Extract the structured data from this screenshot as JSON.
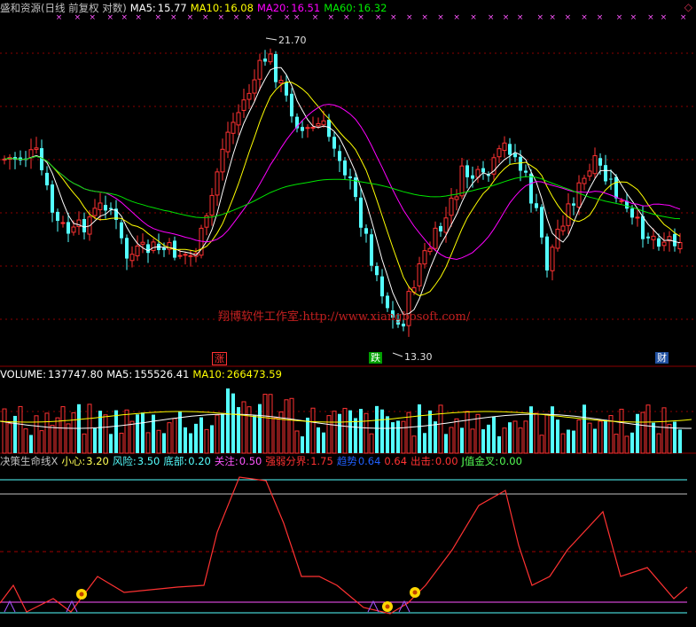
{
  "header": {
    "title": "盛和资源(日线 前复权 对数)",
    "ma5_label": "MA5:",
    "ma5": "15.77",
    "ma10_label": "MA10:",
    "ma10": "16.08",
    "ma20_label": "MA20:",
    "ma20": "16.51",
    "ma60_label": "MA60:",
    "ma60": "16.32",
    "close_icon": "diamond-icon"
  },
  "price_panel": {
    "high_label": "21.70",
    "low_label": "13.30",
    "watermark": "翔博软件工作室:http://www.xiangbosoft.com/",
    "tag_up": "涨",
    "tag_down": "跌",
    "tag_fin": "财"
  },
  "volume_panel": {
    "volume_label": "VOLUME:",
    "volume": "137747.80",
    "ma5_label": "MA5:",
    "ma5": "155526.41",
    "ma10_label": "MA10:",
    "ma10": "266473.59"
  },
  "indicator_panel": {
    "name": "决策生命线X",
    "xiaoxin_label": "小心:",
    "xiaoxin": "3.20",
    "fengxian_label": "风险:",
    "fengxian": "3.50",
    "dibu_label": "底部:",
    "dibu": "0.20",
    "guanzhu_label": "关注:",
    "guanzhu": "0.50",
    "qiangruo_label": "强弱分界:",
    "qiangruo": "1.75",
    "qushi_label": "趋势",
    "qushi": "0.64",
    "qushi2": "0.64",
    "chuji_label": "出击:",
    "chuji": "0.00",
    "jinjiaocha_label": "J值金叉:",
    "jinjiaocha": "0.00"
  },
  "colors": {
    "up": "#ff3232",
    "down": "#54ffff",
    "ma5": "#ffffff",
    "ma10": "#ffff00",
    "ma20": "#ff00ff",
    "ma60": "#00e600",
    "grid": "#8b0000"
  },
  "chart_data": {
    "type": "candlestick",
    "scale": "log",
    "y_range_price": [
      12.8,
      22.6
    ],
    "high": 21.7,
    "low": 13.3,
    "last_close_approx": 15.8,
    "moving_averages": {
      "MA5": 15.77,
      "MA10": 16.08,
      "MA20": 16.51,
      "MA60": 16.32
    },
    "volume_last": 137747.8,
    "volume_ma5": 155526.41,
    "volume_ma10": 266473.59,
    "indicator_levels": {
      "xiaoxin": 3.2,
      "fengxian": 3.5,
      "dibu": 0.2,
      "guanzhu": 0.5,
      "qiangruo": 1.75
    }
  }
}
